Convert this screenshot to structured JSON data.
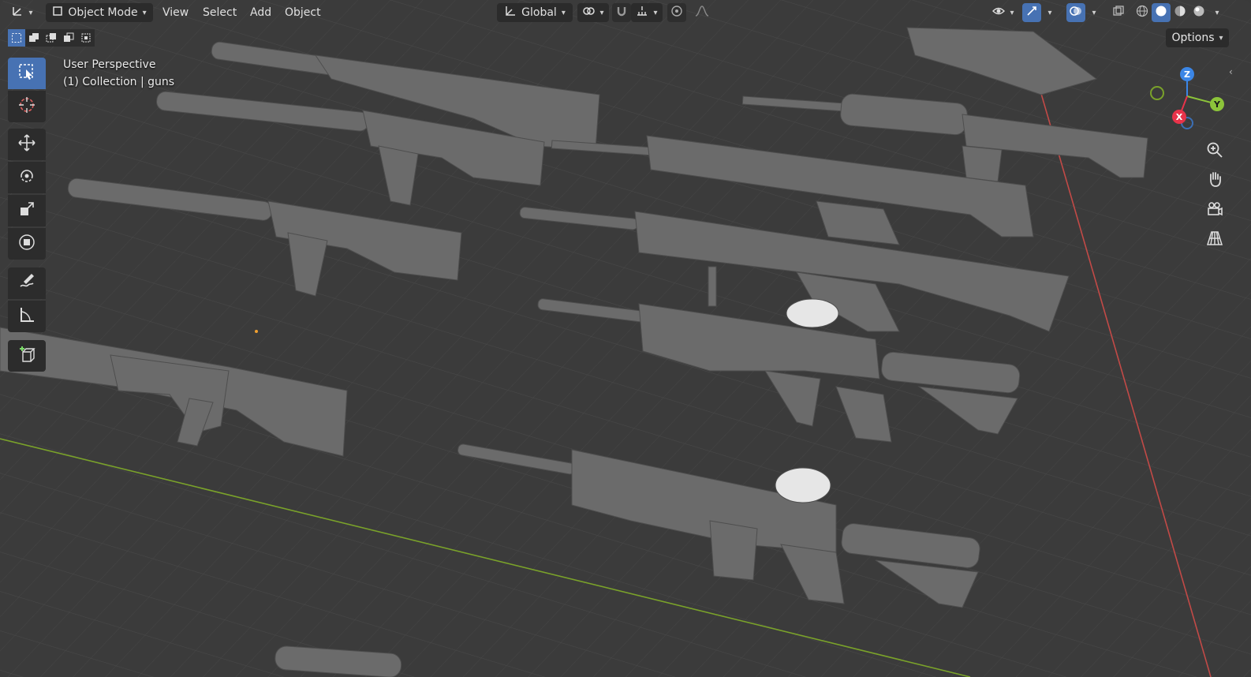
{
  "header": {
    "editor_type_icon": "axes-icon",
    "mode": {
      "label": "Object Mode",
      "icon": "cube-mode-icon"
    },
    "menus": [
      "View",
      "Select",
      "Add",
      "Object"
    ],
    "transform_orientation": {
      "label": "Global",
      "icon": "orientation-axes-icon"
    },
    "pivot_icon": "link-pivot-icon",
    "snap_icons": [
      "magnet-icon",
      "snap-grid-icon"
    ],
    "proportional_icons": [
      "proportional-circle-icon",
      "falloff-curve-icon"
    ],
    "right_icons": [
      "eye-icon",
      "gizmo-icon",
      "overlay-icon",
      "xray-icon",
      "wireframe-icon",
      "solid-icon",
      "material-icon",
      "rendered-icon"
    ]
  },
  "select_modes": [
    "select-new-icon",
    "select-extend-icon",
    "select-subtract-icon",
    "select-invert-icon",
    "select-intersect-icon"
  ],
  "options_label": "Options",
  "viewport_info": {
    "line1": "User Perspective",
    "line2": "(1) Collection | guns"
  },
  "tools": [
    {
      "name": "select-box-icon",
      "active": true
    },
    {
      "name": "cursor-icon",
      "active": false
    },
    {
      "name": "move-icon",
      "active": false
    },
    {
      "name": "rotate-icon",
      "active": false
    },
    {
      "name": "scale-icon",
      "active": false
    },
    {
      "name": "transform-icon",
      "active": false
    },
    {
      "name": "annotate-icon",
      "active": false
    },
    {
      "name": "measure-icon",
      "active": false
    },
    {
      "name": "add-cube-icon",
      "active": false
    }
  ],
  "gizmo": {
    "z": "Z",
    "y": "Y",
    "x": "X"
  },
  "nav_buttons": [
    "zoom-icon",
    "pan-hand-icon",
    "camera-icon",
    "perspective-grid-icon"
  ],
  "colors": {
    "accent": "#4772b3",
    "x_axis": "#e8334a",
    "y_axis": "#8cc43a",
    "z_axis": "#3b86e6",
    "grid_x_line": "#c24a47",
    "grid_y_line": "#7aa22a"
  }
}
